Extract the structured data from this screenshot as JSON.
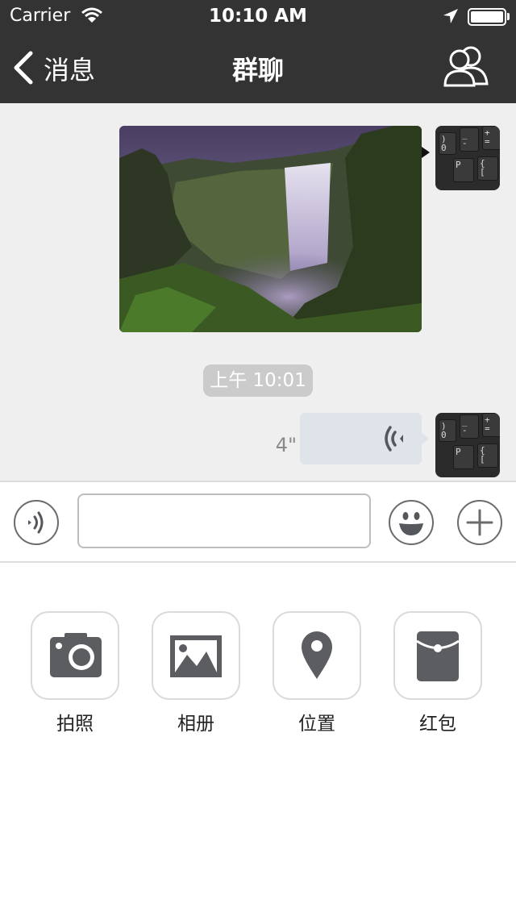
{
  "status_bar": {
    "carrier": "Carrier",
    "time": "10:10 AM",
    "wifi_icon": "wifi-icon",
    "location_icon": "location-arrow-icon",
    "battery_icon": "battery-full-icon"
  },
  "nav": {
    "back_label": "消息",
    "title": "群聊",
    "group_icon": "group-members-icon"
  },
  "chat": {
    "timestamp": "上午 10:01",
    "voice_duration": "4\"",
    "messages": [
      {
        "type": "image",
        "side": "right",
        "subject": "waterfall landscape photo"
      },
      {
        "type": "voice",
        "side": "right"
      }
    ]
  },
  "input": {
    "value": "",
    "placeholder": ""
  },
  "tools": [
    {
      "label": "拍照",
      "icon": "camera-icon"
    },
    {
      "label": "相册",
      "icon": "photo-album-icon"
    },
    {
      "label": "位置",
      "icon": "location-pin-icon"
    },
    {
      "label": "红包",
      "icon": "red-envelope-icon"
    }
  ],
  "colors": {
    "nav_bg": "#333333",
    "chat_bg": "#efefef",
    "voice_bubble": "#dfe4ea",
    "icon_gray": "#5b5d61"
  }
}
